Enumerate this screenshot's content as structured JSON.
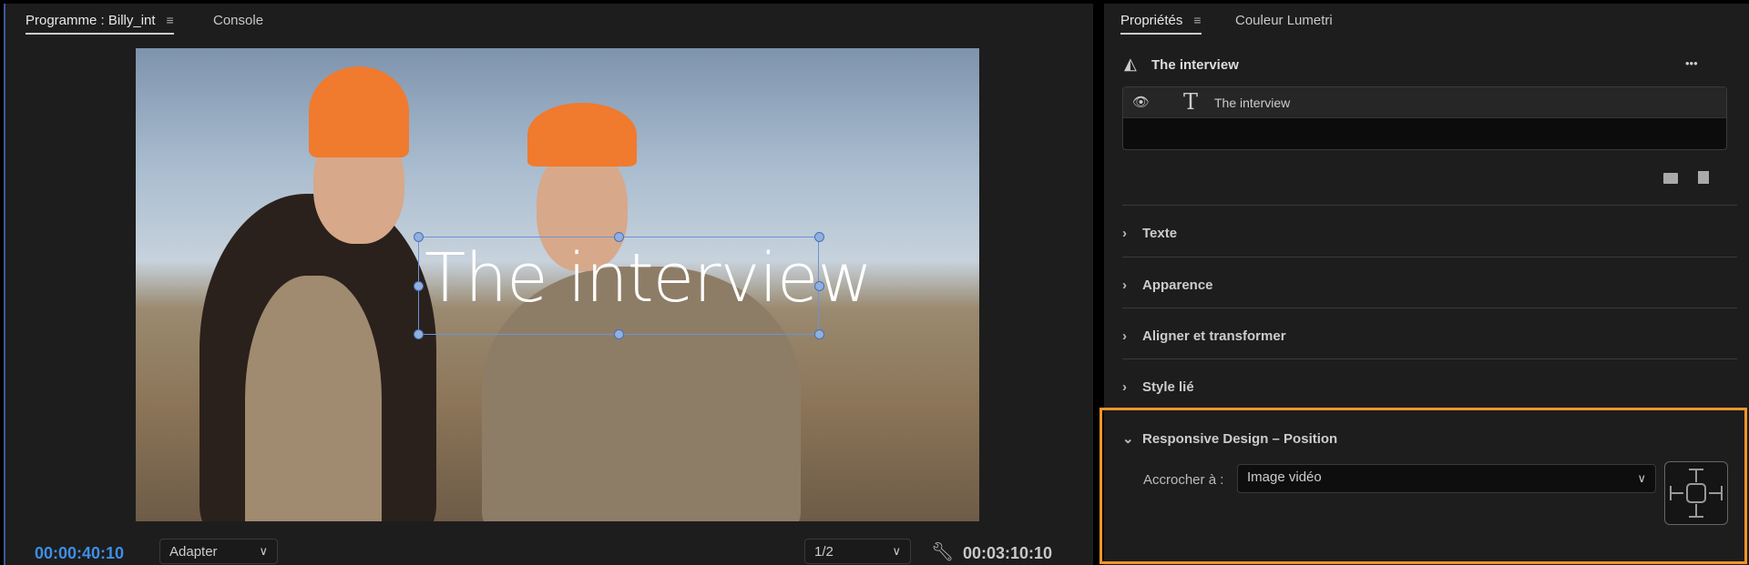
{
  "program": {
    "tab_label": "Programme : Billy_int",
    "tab2_label": "Console",
    "title_text": "The interview",
    "timecode_current": "00:00:40:10",
    "zoom_select": "Adapter",
    "resolution_select": "1/2",
    "timecode_duration": "00:03:10:10"
  },
  "properties": {
    "tab_label": "Propriétés",
    "tab2_label": "Couleur Lumetri",
    "clip_name": "The interview",
    "more": "•••",
    "layer_name": "The interview",
    "sections": [
      "Texte",
      "Apparence",
      "Aligner et transformer",
      "Style lié"
    ],
    "responsive": {
      "title": "Responsive Design – Position",
      "pin_label": "Accrocher à :",
      "pin_value": "Image vidéo"
    }
  },
  "colors": {
    "highlight": "#f0952a",
    "timecode": "#3f8ee8"
  }
}
